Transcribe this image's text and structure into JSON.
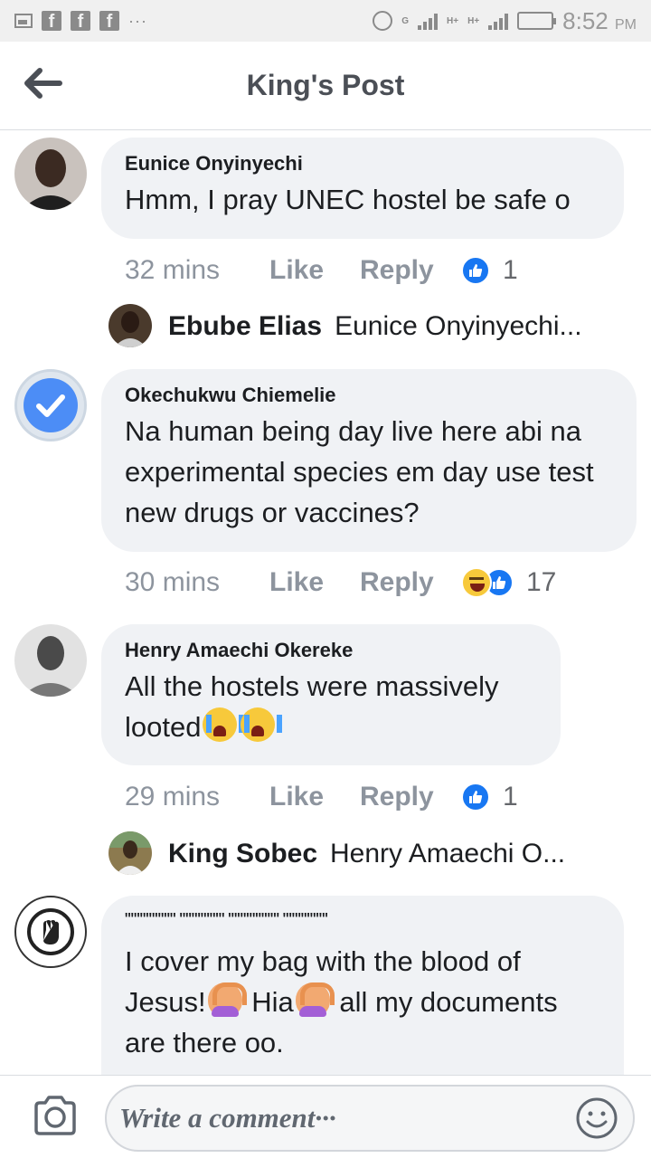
{
  "status_bar": {
    "time": "8:52",
    "ampm": "PM",
    "net_tags": [
      "G",
      "H+",
      "H+"
    ],
    "icons": [
      "image-icon",
      "facebook-icon",
      "facebook-icon",
      "facebook-icon",
      "more-icon",
      "alarm-icon",
      "signal-icon",
      "battery-icon"
    ]
  },
  "header": {
    "title": "King's Post",
    "back_icon": "back-arrow-icon"
  },
  "comments": [
    {
      "author": "Eunice Onyinyechi",
      "text": "Hmm, I pray UNEC hostel be safe o",
      "time": "32 mins",
      "like_label": "Like",
      "reply_label": "Reply",
      "reactions": [
        "like"
      ],
      "reaction_count": "1",
      "reply_preview": {
        "name": "Ebube Elias",
        "snippet": "Eunice Onyinyechi..."
      }
    },
    {
      "author": "Okechukwu Chiemelie",
      "text": "Na human being day live here abi na experimental species em day use test new drugs or vaccines?",
      "time": "30 mins",
      "like_label": "Like",
      "reply_label": "Reply",
      "reactions": [
        "haha",
        "like"
      ],
      "reaction_count": "17"
    },
    {
      "author": "Henry Amaechi Okereke",
      "text": "All the hostels were massively looted",
      "emojis": [
        "crying-face",
        "crying-face"
      ],
      "time": "29 mins",
      "like_label": "Like",
      "reply_label": "Reply",
      "reactions": [
        "like"
      ],
      "reaction_count": "1",
      "reply_preview": {
        "name": "King Sobec",
        "snippet": "Henry Amaechi O..."
      }
    },
    {
      "author": "ꞌꞌꞌꞌꞌꞌꞌꞌꞌꞌꞌꞌꞌꞌꞌꞌꞌ ꞌꞌꞌꞌꞌꞌꞌꞌꞌꞌꞌꞌꞌꞌꞌ ꞌꞌꞌꞌꞌꞌꞌꞌꞌꞌꞌꞌꞌꞌꞌꞌꞌ ꞌꞌꞌꞌꞌꞌꞌꞌꞌꞌꞌꞌꞌꞌꞌ",
      "text_part1": "I cover my bag with the blood of Jesus!",
      "text_part2": " Hia",
      "text_part3": " all my documents are there oo.",
      "emojis": [
        "hands-on-head-person",
        "hands-on-head-person"
      ]
    }
  ],
  "composer": {
    "placeholder": "Write a comment···",
    "camera_icon": "camera-icon",
    "emoji_icon": "smiley-icon"
  },
  "colors": {
    "like_blue": "#1877f2",
    "bubble_bg": "#f0f2f5",
    "meta_gray": "#8d949e"
  }
}
